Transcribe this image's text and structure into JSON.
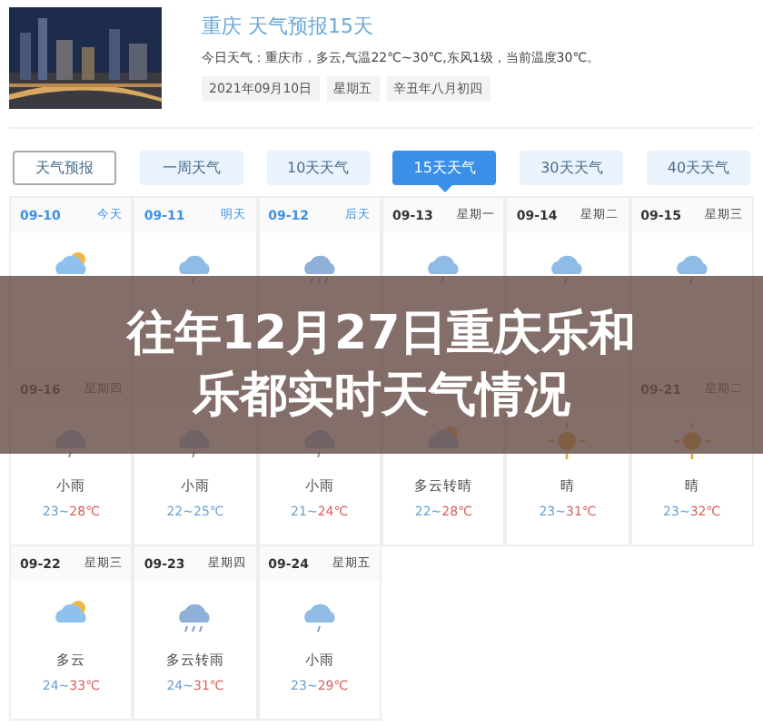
{
  "header": {
    "title": "重庆 天气预报15天",
    "summary": "今日天气：重庆市，多云,气温22℃~30℃,东风1级，当前温度30℃。",
    "date_chips": [
      "2021年09月10日",
      "星期五",
      "辛丑年八月初四"
    ]
  },
  "tabs": [
    {
      "label": "天气预报",
      "kind": "outline",
      "selected": false
    },
    {
      "label": "一周天气",
      "kind": "fill",
      "selected": false
    },
    {
      "label": "10天天气",
      "kind": "fill",
      "selected": false
    },
    {
      "label": "15天天气",
      "kind": "fill",
      "selected": true
    },
    {
      "label": "30天天气",
      "kind": "fill",
      "selected": false
    },
    {
      "label": "40天天气",
      "kind": "fill",
      "selected": false
    }
  ],
  "days": [
    {
      "date": "09-10",
      "day": "今天",
      "near": true,
      "kind": "partlycloudy"
    },
    {
      "date": "09-11",
      "day": "明天",
      "near": true,
      "kind": "rain"
    },
    {
      "date": "09-12",
      "day": "后天",
      "near": true,
      "kind": "showers"
    },
    {
      "date": "09-13",
      "day": "星期一",
      "near": false,
      "kind": "rain"
    },
    {
      "date": "09-14",
      "day": "星期二",
      "near": false,
      "kind": "rain"
    },
    {
      "date": "09-15",
      "day": "星期三",
      "near": false,
      "kind": "rain"
    },
    {
      "date": "09-16",
      "day": "星期四",
      "near": false,
      "kind": "rain",
      "weather": "小雨",
      "low": "23~",
      "high": "28℃"
    },
    {
      "kind": "rain",
      "weather": "小雨",
      "low": "22~25℃"
    },
    {
      "kind": "rain",
      "weather": "小雨",
      "low": "21~",
      "high": "24℃"
    },
    {
      "kind": "partlycloudy",
      "weather": "多云转晴",
      "low": "22~",
      "high": "28℃"
    },
    {
      "kind": "sunny",
      "weather": "晴",
      "low": "23~",
      "high": "31℃"
    },
    {
      "date": "09-21",
      "day": "星期二",
      "near": false,
      "kind": "sunny",
      "weather": "晴",
      "low": "23~",
      "high": "32℃"
    },
    {
      "date": "09-22",
      "day": "星期三",
      "near": false,
      "kind": "partlycloudy",
      "weather": "多云",
      "low": "24~",
      "high": "33℃"
    },
    {
      "date": "09-23",
      "day": "星期四",
      "near": false,
      "kind": "showers",
      "weather": "多云转雨",
      "low": "24~",
      "high": "31℃"
    },
    {
      "date": "09-24",
      "day": "星期五",
      "near": false,
      "kind": "rain",
      "weather": "小雨",
      "low": "23~",
      "high": "29℃"
    }
  ],
  "headline": [
    "往年12月27日重庆乐和",
    "乐都实时天气情况"
  ]
}
